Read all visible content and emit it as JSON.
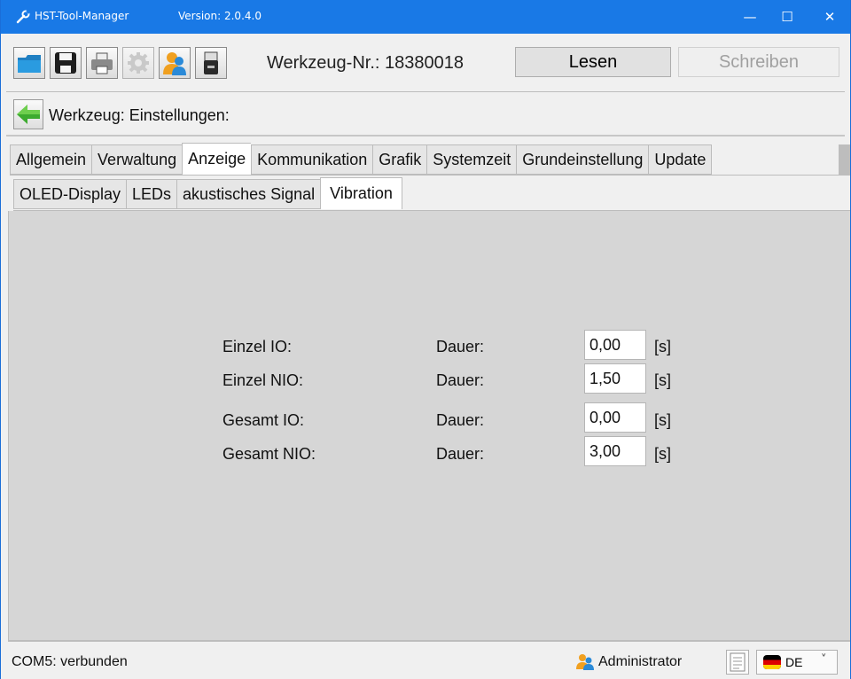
{
  "window": {
    "title": "HST-Tool-Manager",
    "version": "Version: 2.0.4.0",
    "controls": {
      "minimize": "—",
      "maximize": "☐",
      "close": "✕"
    }
  },
  "toolbar": {
    "icons": [
      "open-folder-icon",
      "save-icon",
      "print-icon",
      "settings-icon",
      "user-icon",
      "usb-icon"
    ],
    "werkzeug_nr": "Werkzeug-Nr.: 18380018",
    "lesen": "Lesen",
    "schreiben": "Schreiben"
  },
  "breadcrumb": {
    "text": "Werkzeug: Einstellungen:"
  },
  "tabs_main": [
    "Allgemein",
    "Verwaltung",
    "Anzeige",
    "Kommunikation",
    "Grafik",
    "Systemzeit",
    "Grundeinstellung",
    "Update"
  ],
  "tabs_main_active": "Anzeige",
  "tabs_sub": [
    "OLED-Display",
    "LEDs",
    "akustisches Signal",
    "Vibration"
  ],
  "tabs_sub_active": "Vibration",
  "vibration": {
    "rows": [
      {
        "label": "Einzel IO:",
        "dauer": "Dauer:",
        "value": "0,00",
        "unit": "[s]"
      },
      {
        "label": "Einzel NIO:",
        "dauer": "Dauer:",
        "value": "1,50",
        "unit": "[s]"
      },
      {
        "label": "Gesamt IO:",
        "dauer": "Dauer:",
        "value": "0,00",
        "unit": "[s]"
      },
      {
        "label": "Gesamt NIO:",
        "dauer": "Dauer:",
        "value": "3,00",
        "unit": "[s]"
      }
    ]
  },
  "status": {
    "connection": "COM5: verbunden",
    "user": "Administrator",
    "language": "DE",
    "chevron": "˅"
  },
  "colors": {
    "titlebar": "#1979e6",
    "content_bg": "#d6d6d6",
    "accent_green": "#3cab2f"
  }
}
